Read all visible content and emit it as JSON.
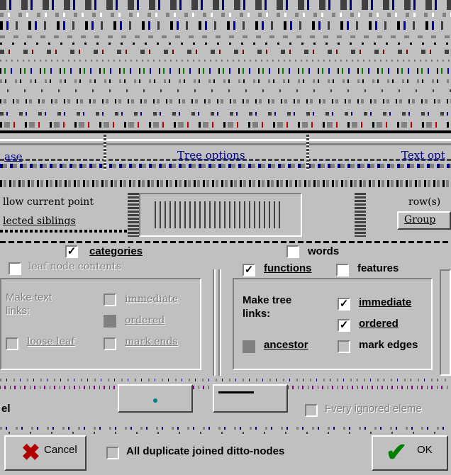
{
  "tabs": {
    "left": "Tree options",
    "right": "Text opt"
  },
  "text_panel": {
    "options": {
      "categories": "categories",
      "leaf_node_contents": "leaf node contents",
      "words": "words",
      "functions": "functions",
      "features": "features"
    },
    "header_left": "llow current point",
    "header_right": "row(s)",
    "selected_siblings": "lected siblings",
    "group": "Group"
  },
  "text_links": {
    "title": "Make text links:",
    "immediate": "immediate",
    "ordered": "ordered",
    "loose_leaf": "loose leaf",
    "mark_ends": "mark ends"
  },
  "tree_links": {
    "title": "Make tree links:",
    "immediate": "immediate",
    "ordered": "ordered",
    "ancestor": "ancestor",
    "mark_edges": "mark edges"
  },
  "bottom": {
    "ignored_elements": "Fvery ignored eleme",
    "duplicate_ditto": "All duplicate joined ditto-nodes"
  },
  "buttons": {
    "cancel": "Cancel",
    "ok": "OK"
  },
  "colors": {
    "face": "#c0c0c0",
    "shadow": "#808080",
    "highlight": "#ffffff",
    "link": "#000080",
    "cancel_x": "#b00000",
    "ok_check": "#008000"
  },
  "icons": [
    "red-x-icon",
    "green-check-icon",
    "checkbox-checkmark-icon"
  ]
}
